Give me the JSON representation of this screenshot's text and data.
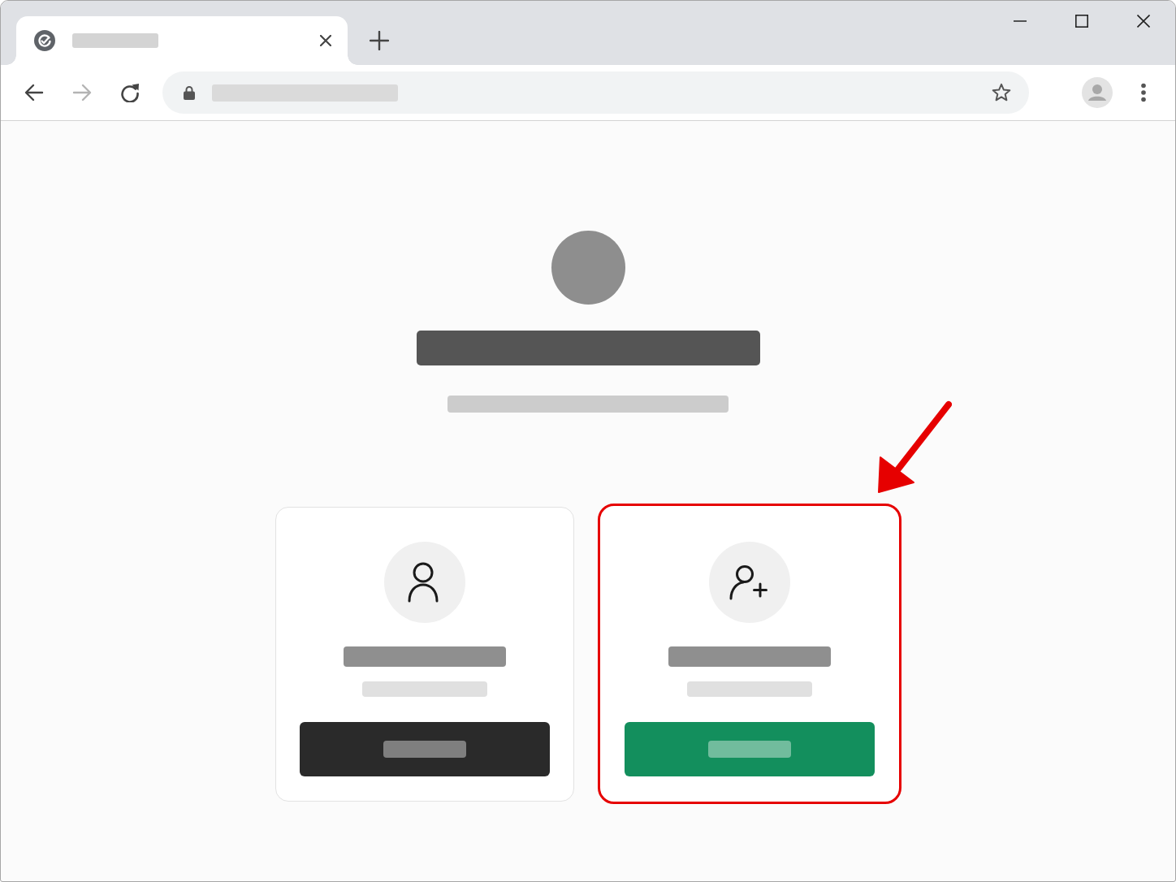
{
  "browser": {
    "tabs": [
      {
        "selected": true
      }
    ],
    "nav_buttons": [
      {
        "kind": "back",
        "disabled": false
      },
      {
        "kind": "forward",
        "disabled": true
      },
      {
        "kind": "reload",
        "disabled": false
      }
    ]
  },
  "options": [
    {
      "kind": "existing",
      "highlighted": false,
      "color": "#2a2a2a"
    },
    {
      "kind": "new",
      "highlighted": true,
      "color": "#138f5d"
    }
  ]
}
